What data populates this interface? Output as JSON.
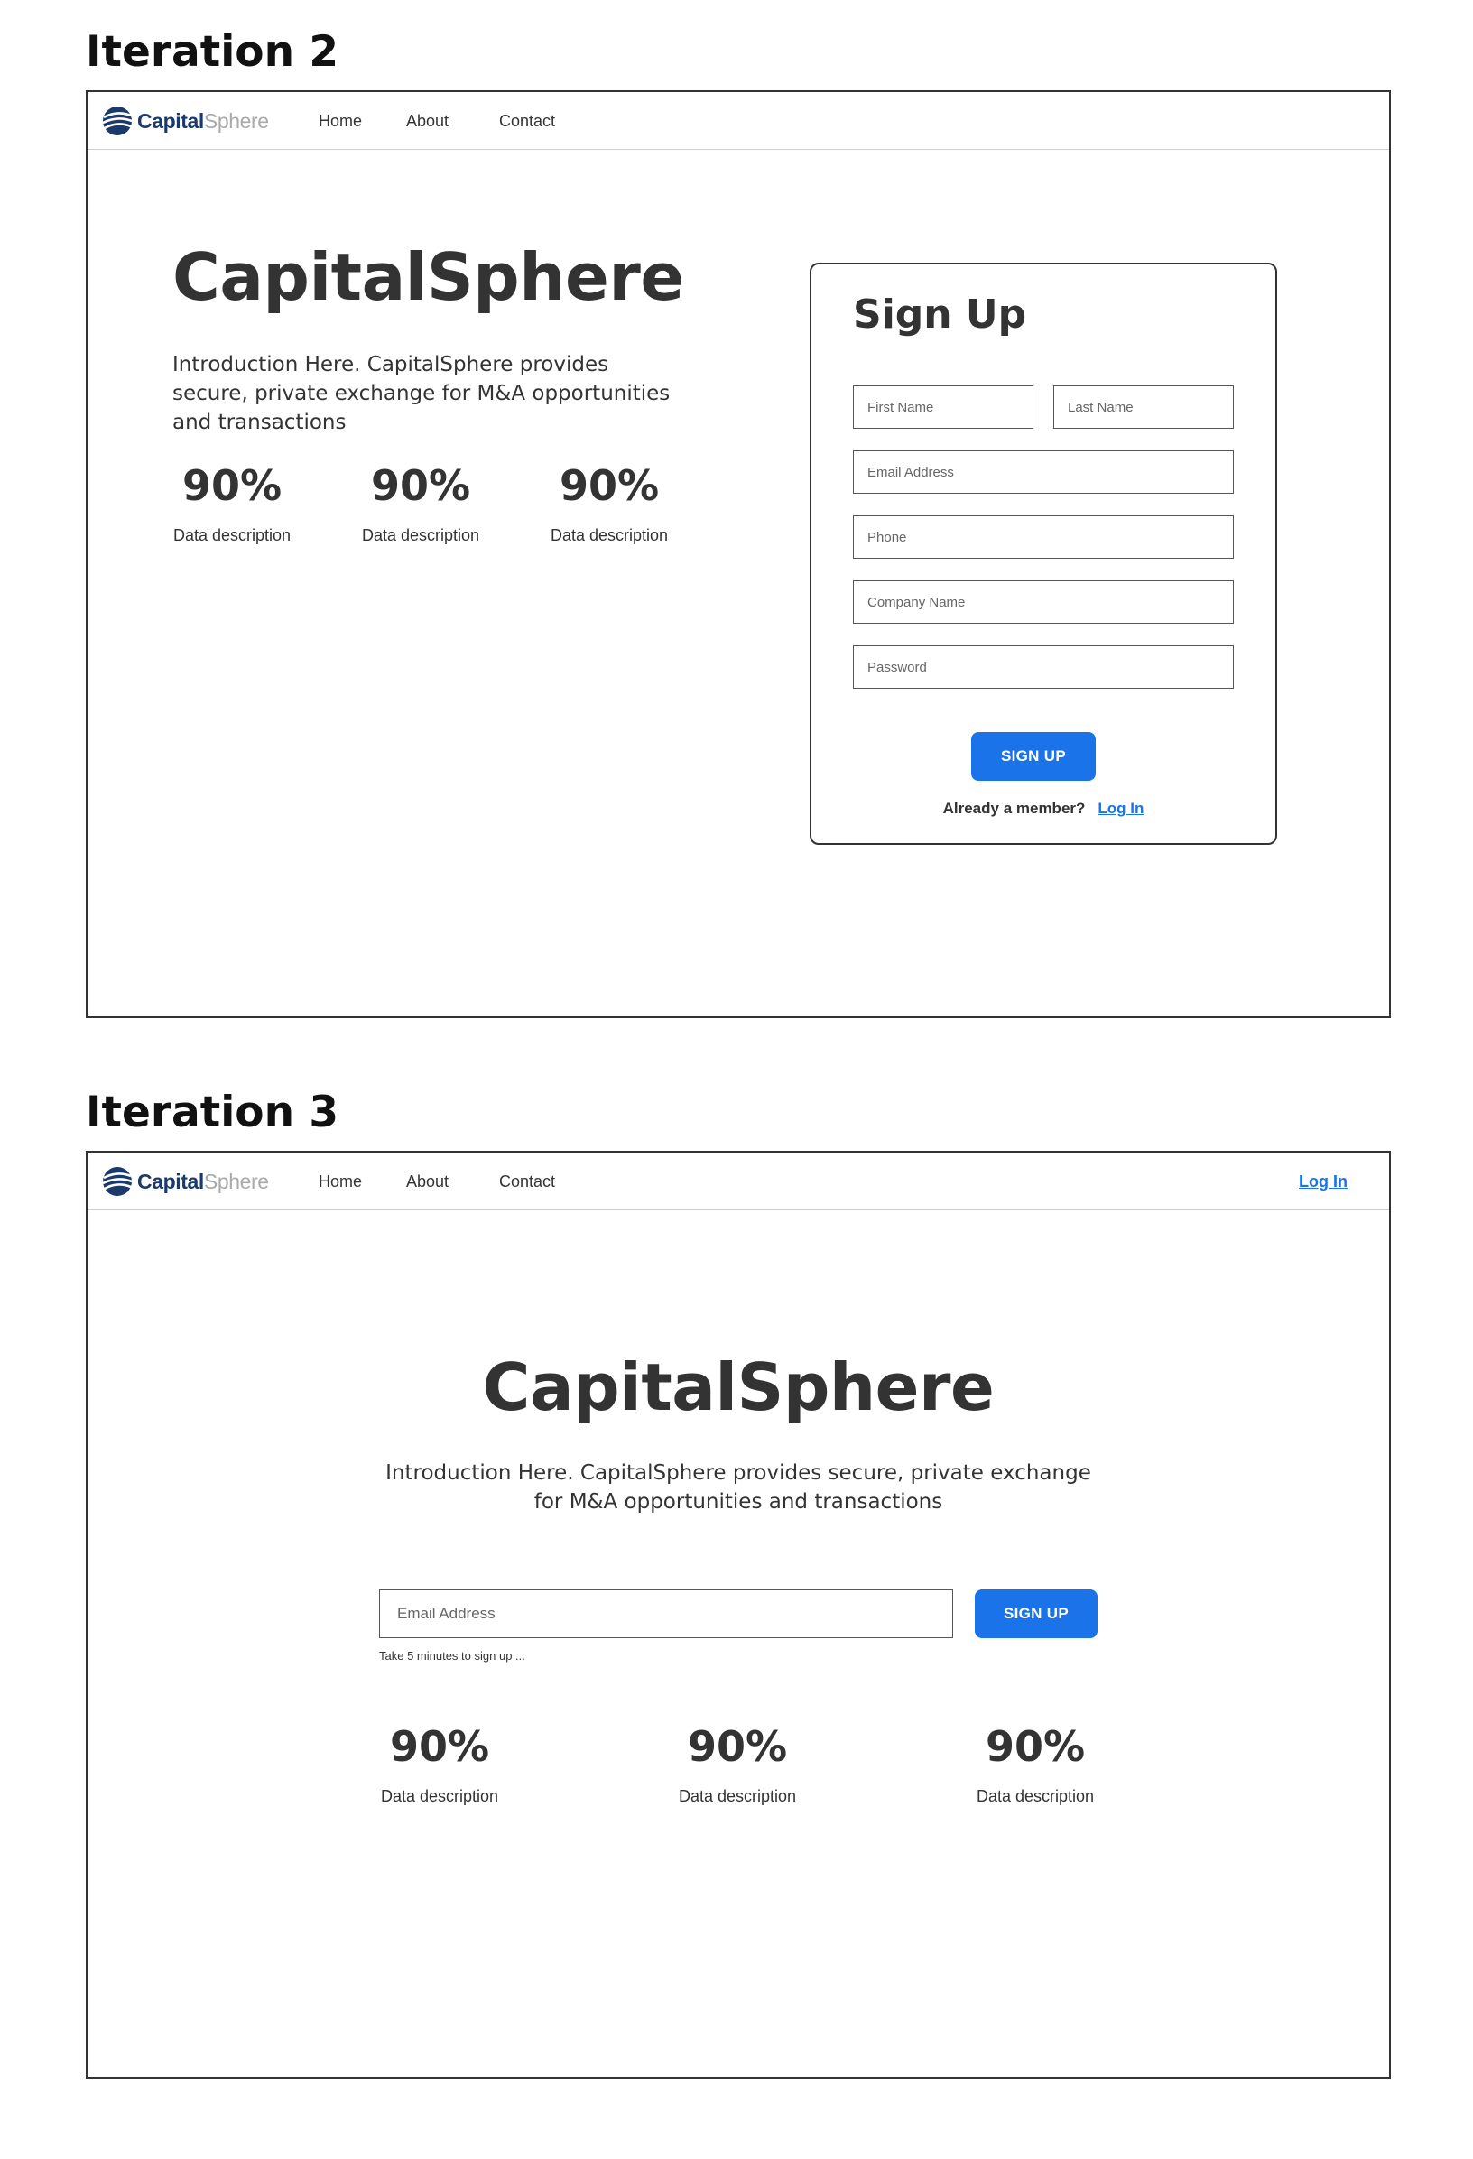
{
  "brand": {
    "name_strong": "Capital",
    "name_light": "Sphere",
    "colors": {
      "strong": "#1b3a6b",
      "light": "#a9a9a9"
    }
  },
  "accent_color": "#1a73e8",
  "nav": {
    "links": [
      "Home",
      "About",
      "Contact"
    ],
    "login_label": "Log In"
  },
  "iteration2": {
    "label": "Iteration 2",
    "hero": {
      "title": "CapitalSphere",
      "intro": "Introduction Here. CapitalSphere provides secure, private exchange for M&A opportunities and transactions"
    },
    "stats": [
      {
        "value": "90%",
        "label": "Data description"
      },
      {
        "value": "90%",
        "label": "Data description"
      },
      {
        "value": "90%",
        "label": "Data description"
      }
    ],
    "signup": {
      "title": "Sign Up",
      "fields": {
        "first_name": "First Name",
        "last_name": "Last Name",
        "email": "Email Address",
        "phone": "Phone",
        "company": "Company Name",
        "password": "Password"
      },
      "button": "SIGN UP",
      "member_text": "Already a member?",
      "login_link": "Log In"
    }
  },
  "iteration3": {
    "label": "Iteration 3",
    "hero": {
      "title": "CapitalSphere",
      "intro_line1": "Introduction Here. CapitalSphere provides secure, private exchange",
      "intro_line2": "for M&A opportunities and transactions"
    },
    "email_placeholder": "Email Address",
    "button": "SIGN UP",
    "hint": "Take 5 minutes to sign up ...",
    "stats": [
      {
        "value": "90%",
        "label": "Data description"
      },
      {
        "value": "90%",
        "label": "Data description"
      },
      {
        "value": "90%",
        "label": "Data description"
      }
    ]
  }
}
